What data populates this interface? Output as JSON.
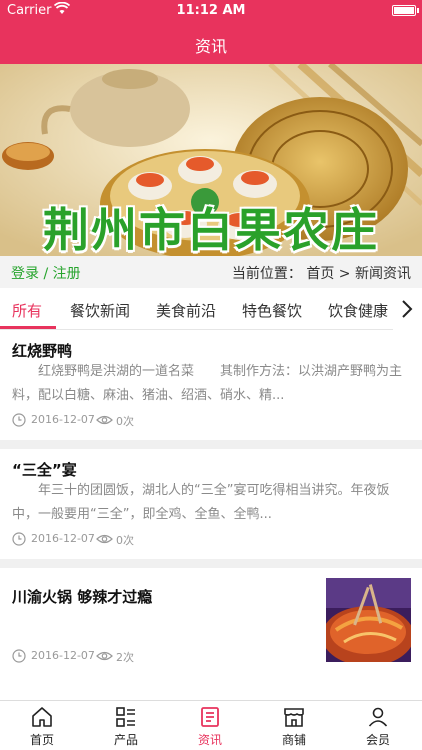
{
  "status_bar": {
    "carrier": "Carrier",
    "time": "11:12 AM"
  },
  "nav": {
    "title": "资讯"
  },
  "banner": {
    "text": "荆州市白果农庄"
  },
  "login_row": {
    "login_text": "登录 / 注册",
    "breadcrumb": "当前位置： 首页 > 新闻资讯"
  },
  "tabs": [
    "所有",
    "餐饮新闻",
    "美食前沿",
    "特色餐饮",
    "饮食健康"
  ],
  "active_tab": "所有",
  "articles": [
    {
      "title": "红烧野鸭",
      "summary": "红烧野鸭是洪湖的一道名菜　　其制作方法：以洪湖产野鸭为主料，配以白糖、麻油、猪油、绍酒、硝水、精...",
      "date": "2016-12-07",
      "views": "0次"
    },
    {
      "title": "“三全”宴",
      "summary": "年三十的团圆饭，湖北人的“三全”宴可吃得相当讲究。年夜饭中，一般要用“三全”，即全鸡、全鱼、全鸭...",
      "date": "2016-12-07",
      "views": "0次"
    },
    {
      "title": "川渝火锅 够辣才过瘾",
      "date": "2016-12-07",
      "views": "2次"
    }
  ],
  "tabbar": [
    {
      "label": "首页",
      "icon": "home-icon"
    },
    {
      "label": "产品",
      "icon": "list-icon"
    },
    {
      "label": "资讯",
      "icon": "news-icon"
    },
    {
      "label": "商铺",
      "icon": "store-icon"
    },
    {
      "label": "会员",
      "icon": "user-icon"
    }
  ],
  "active_tabbar": "资讯",
  "colors": {
    "brand": "#e8335d",
    "login_green": "#27a42d",
    "banner_text": "#2aa12a"
  }
}
